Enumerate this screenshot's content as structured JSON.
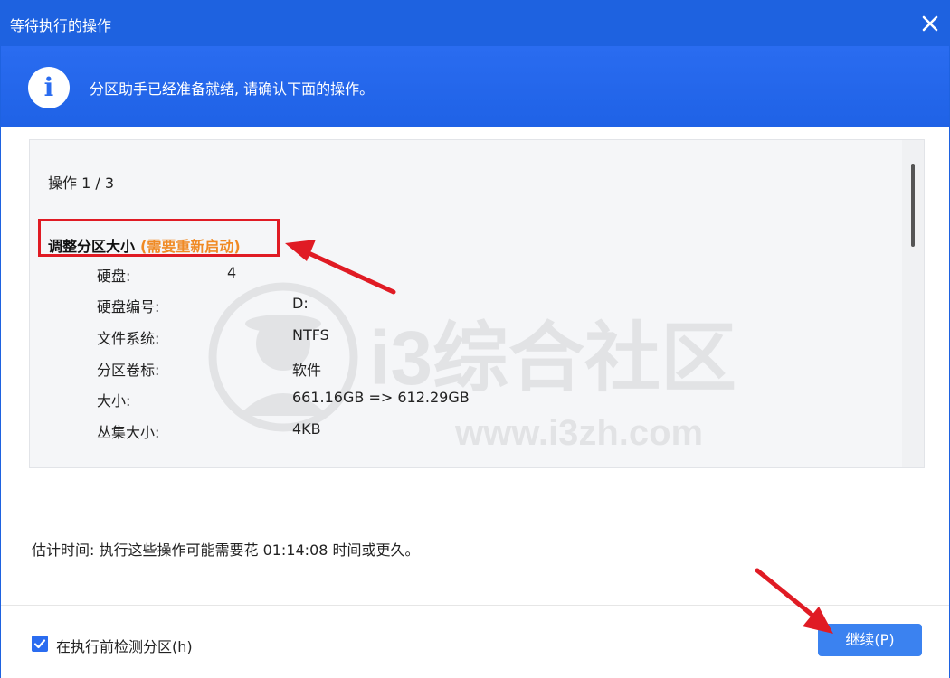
{
  "window": {
    "title": "等待执行的操作",
    "close_icon": "close-icon"
  },
  "banner": {
    "icon": "info-icon",
    "icon_glyph": "i",
    "message": "分区助手已经准备就绪, 请确认下面的操作。"
  },
  "operations": {
    "counter": "操作 1 / 3",
    "current": {
      "title": "调整分区大小",
      "note": "(需要重新启动)",
      "details": [
        {
          "label": "硬盘:",
          "value": "4"
        },
        {
          "label": "硬盘编号:",
          "value": "D:"
        },
        {
          "label": "文件系统:",
          "value": "NTFS"
        },
        {
          "label": "分区卷标:",
          "value": "软件"
        },
        {
          "label": "大小:",
          "value": "661.16GB => 612.29GB"
        },
        {
          "label": "丛集大小:",
          "value": "4KB"
        }
      ]
    }
  },
  "watermark": {
    "name": "i3综合社区",
    "url": "www.i3zh.com"
  },
  "estimate": {
    "text": "估计时间: 执行这些操作可能需要花 01:14:08 时间或更久。"
  },
  "footer": {
    "checkbox_checked": true,
    "checkbox_label": "在执行前检测分区(h)",
    "continue_label": "继续(P)"
  },
  "colors": {
    "brand_blue": "#1e62e0",
    "note_orange": "#f08a24",
    "highlight_red": "#e01b24",
    "button_blue": "#3b82f0"
  }
}
